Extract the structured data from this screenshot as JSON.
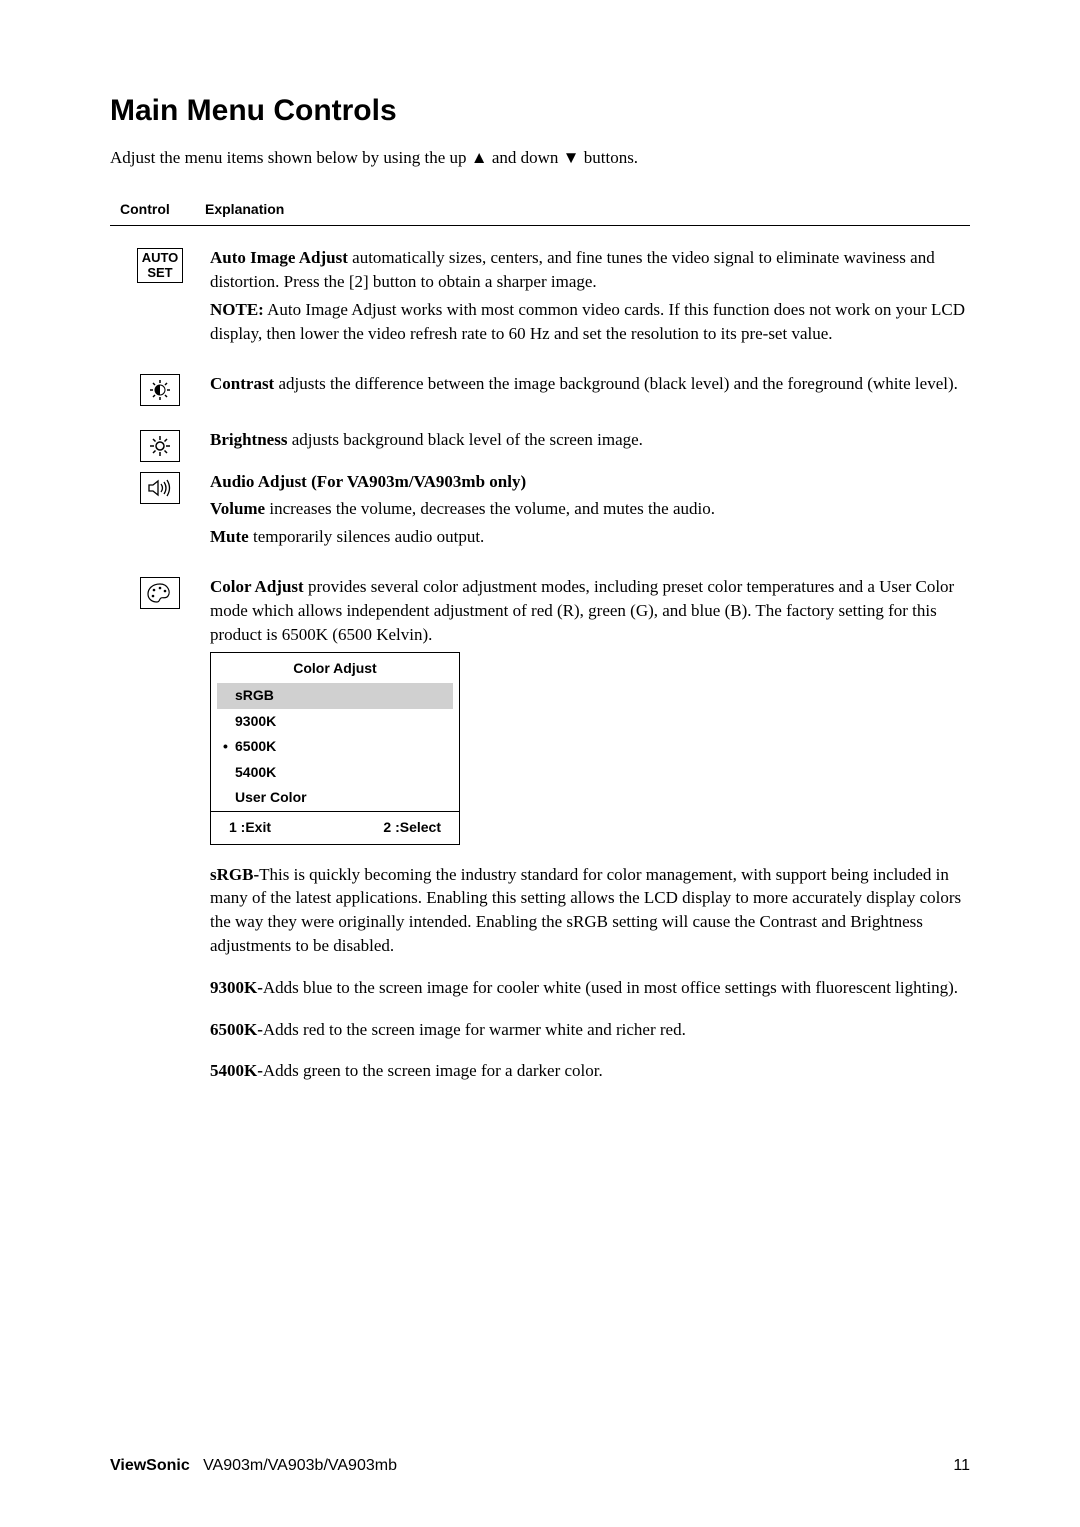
{
  "title": "Main Menu Controls",
  "intro_pre": "Adjust the menu items shown below by using the up ",
  "intro_mid": " and down ",
  "intro_post": " buttons.",
  "header": {
    "control": "Control",
    "explanation": "Explanation"
  },
  "items": {
    "auto": {
      "icon_line1": "AUTO",
      "icon_line2": "SET",
      "lead": "Auto Image Adjust",
      "body": " automatically sizes, centers, and fine tunes the video signal to eliminate waviness and distortion. Press the [2] button to obtain a sharper image.",
      "note_lead": "NOTE:",
      "note_body": " Auto Image Adjust works with most common video cards. If this function does not work on your LCD display, then lower the video refresh rate to 60 Hz and set the resolution to its pre-set value."
    },
    "contrast": {
      "lead": "Contrast",
      "body": " adjusts the difference between the image background  (black level) and the foreground (white level)."
    },
    "brightness": {
      "lead": "Brightness",
      "body": " adjusts background black level of the screen image."
    },
    "audio": {
      "heading": "Audio Adjust (For VA903m/VA903mb only)",
      "vol_lead": "Volume",
      "vol_body": " increases the volume, decreases the volume, and mutes the audio.",
      "mute_lead": "Mute",
      "mute_body": " temporarily silences audio output."
    },
    "color": {
      "lead": "Color Adjust",
      "body": " provides several color adjustment modes, including preset color temperatures and a User Color mode which allows independent adjustment of red (R), green (G), and blue (B). The factory setting for this product is 6500K (6500 Kelvin)."
    }
  },
  "osd": {
    "title": "Color Adjust",
    "items": [
      "sRGB",
      "9300K",
      "6500K",
      "5400K",
      "User Color"
    ],
    "exit": "1 :Exit",
    "select": "2 :Select"
  },
  "color_desc": {
    "srgb_lead": "sRGB-",
    "srgb_body": "This is quickly becoming the industry standard for color management, with support being included in many of the latest applications. Enabling this setting allows the LCD display to more accurately display colors the way they were originally intended. Enabling the sRGB setting will cause the Contrast and Brightness adjustments to be disabled.",
    "k9300_lead": "9300K-",
    "k9300_body": "Adds blue to the screen image for cooler white (used in most office settings with fluorescent lighting).",
    "k6500_lead": "6500K-",
    "k6500_body": "Adds red to the screen image for warmer white and richer red.",
    "k5400_lead": "5400K-",
    "k5400_body": "Adds green to the screen image for a darker color."
  },
  "footer": {
    "brand": "ViewSonic",
    "model": "   VA903m/VA903b/VA903mb",
    "page": "11"
  }
}
